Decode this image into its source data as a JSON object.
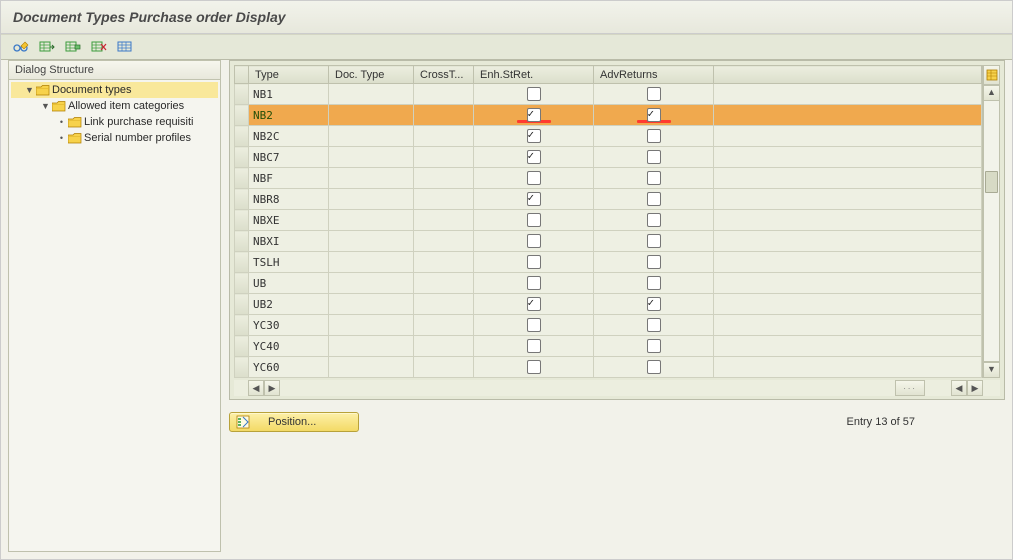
{
  "header": {
    "title": "Document Types Purchase order Display"
  },
  "toolbar": {
    "icons": [
      "glasses-edit-icon",
      "table-next-icon",
      "table-insert-icon",
      "table-delete-icon",
      "table-layout-icon"
    ]
  },
  "tree": {
    "title": "Dialog Structure",
    "nodes": [
      {
        "label": "Document types",
        "selected": true,
        "expander": true,
        "level": 1
      },
      {
        "label": "Allowed item categories",
        "selected": false,
        "expander": true,
        "level": 2
      },
      {
        "label": "Link purchase requisiti",
        "selected": false,
        "expander": false,
        "level": 3
      },
      {
        "label": "Serial number profiles",
        "selected": false,
        "expander": false,
        "level": 3
      }
    ]
  },
  "grid": {
    "columns": [
      {
        "key": "type",
        "label": "Type"
      },
      {
        "key": "doc",
        "label": "Doc. Type"
      },
      {
        "key": "cross",
        "label": "CrossT..."
      },
      {
        "key": "enh",
        "label": "Enh.StRet."
      },
      {
        "key": "adv",
        "label": "AdvReturns"
      }
    ],
    "rows": [
      {
        "type": "NB1",
        "enh": false,
        "adv": false,
        "selected": false,
        "redmark": false
      },
      {
        "type": "NB2",
        "enh": true,
        "adv": true,
        "selected": true,
        "redmark": true
      },
      {
        "type": "NB2C",
        "enh": true,
        "adv": false,
        "selected": false,
        "redmark": false
      },
      {
        "type": "NBC7",
        "enh": true,
        "adv": false,
        "selected": false,
        "redmark": false
      },
      {
        "type": "NBF",
        "enh": false,
        "adv": false,
        "selected": false,
        "redmark": false
      },
      {
        "type": "NBR8",
        "enh": true,
        "adv": false,
        "selected": false,
        "redmark": false
      },
      {
        "type": "NBXE",
        "enh": false,
        "adv": false,
        "selected": false,
        "redmark": false
      },
      {
        "type": "NBXI",
        "enh": false,
        "adv": false,
        "selected": false,
        "redmark": false
      },
      {
        "type": "TSLH",
        "enh": false,
        "adv": false,
        "selected": false,
        "redmark": false
      },
      {
        "type": "UB",
        "enh": false,
        "adv": false,
        "selected": false,
        "redmark": false
      },
      {
        "type": "UB2",
        "enh": true,
        "adv": true,
        "selected": false,
        "redmark": false
      },
      {
        "type": "YC30",
        "enh": false,
        "adv": false,
        "selected": false,
        "redmark": false
      },
      {
        "type": "YC40",
        "enh": false,
        "adv": false,
        "selected": false,
        "redmark": false
      },
      {
        "type": "YC60",
        "enh": false,
        "adv": false,
        "selected": false,
        "redmark": false
      }
    ]
  },
  "footer": {
    "position_label": "Position...",
    "entry_text": "Entry 13 of 57"
  }
}
